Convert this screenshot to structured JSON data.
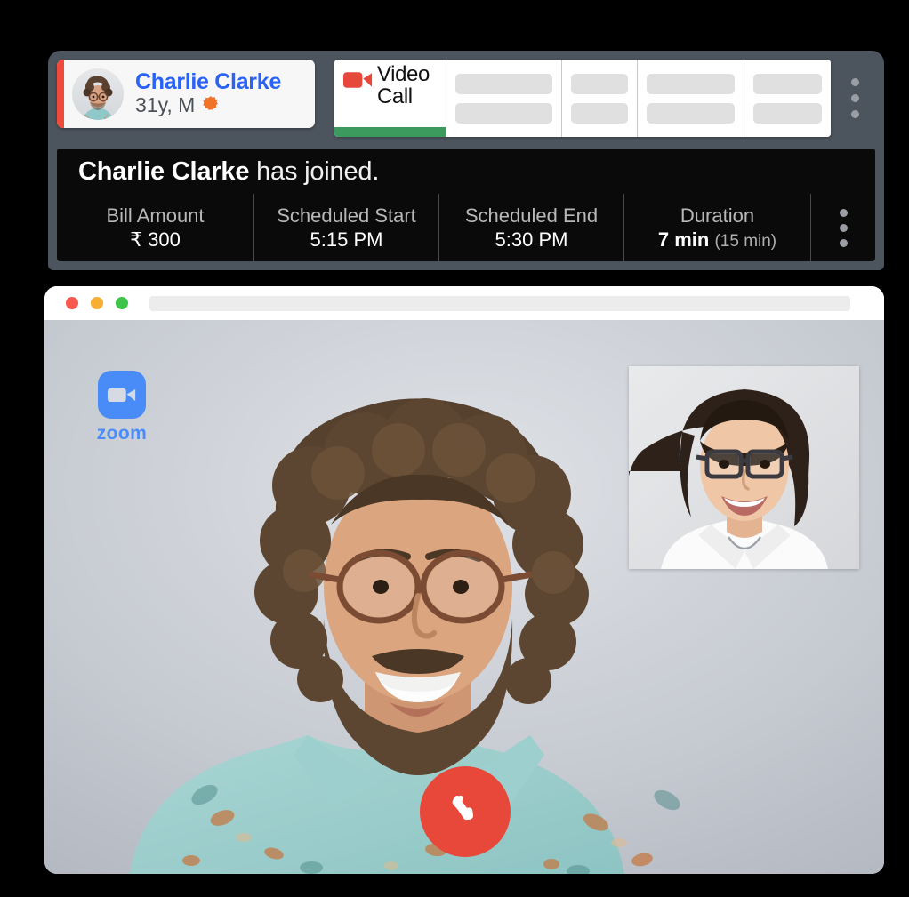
{
  "patient_card": {
    "name": "Charlie Clarke",
    "meta": "31y, M",
    "badge_icon": "starburst-badge",
    "accent_color": "#ef4a3a"
  },
  "tabs": [
    {
      "label_line1": "Video",
      "label_line2": "Call",
      "icon": "video-camera-icon",
      "active": true,
      "status_color": "#3c9a5f"
    },
    {
      "label_line1": "",
      "label_line2": "",
      "active": false
    },
    {
      "label_line1": "",
      "label_line2": "",
      "active": false
    },
    {
      "label_line1": "",
      "label_line2": "",
      "active": false
    },
    {
      "label_line1": "",
      "label_line2": "",
      "active": false
    }
  ],
  "header_menu": {
    "icon": "kebab-menu-icon"
  },
  "banner": {
    "name": "Charlie Clarke",
    "message": " has joined."
  },
  "stats": [
    {
      "label": "Bill Amount",
      "value": "₹ 300",
      "sub": ""
    },
    {
      "label": "Scheduled Start",
      "value": "5:15 PM",
      "sub": ""
    },
    {
      "label": "Scheduled End",
      "value": "5:30 PM",
      "sub": ""
    },
    {
      "label": "Duration",
      "value": "7 min",
      "sub": "(15 min)"
    }
  ],
  "stats_menu": {
    "icon": "kebab-menu-icon"
  },
  "browser": {
    "traffic_lights": [
      "close-red",
      "minimize-yellow",
      "maximize-green"
    ],
    "url_value": "",
    "url_placeholder": ""
  },
  "video_call": {
    "app_name": "zoom",
    "app_logo_color": "#4a8cf7",
    "remote_participant": "Charlie Clarke",
    "self_view_participant": "doctor",
    "end_call_label": "End call",
    "end_call_icon": "phone-handset-icon",
    "end_call_color": "#e8483a"
  }
}
